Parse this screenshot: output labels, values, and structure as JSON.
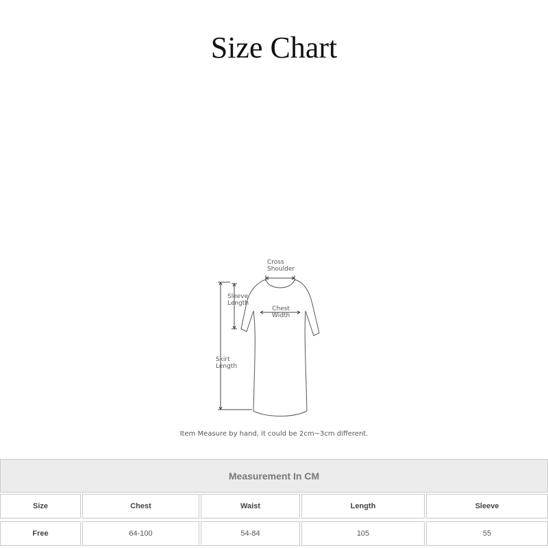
{
  "title": "Size Chart",
  "diagram": {
    "cross_shoulder": [
      "Cross",
      "Shoulder"
    ],
    "sleeve_length": [
      "Sleeve",
      "Length"
    ],
    "chest_width": [
      "Chest",
      "Width"
    ],
    "skirt_length": [
      "Skirt",
      "Length"
    ]
  },
  "note": "Item Measure by hand, it could be 2cm~3cm different.",
  "table": {
    "header": "Measurement In CM",
    "columns": [
      "Size",
      "Chest",
      "Waist",
      "Length",
      "Sleeve"
    ],
    "rows": [
      [
        "Free",
        "64-100",
        "54-84",
        "105",
        "55"
      ]
    ]
  }
}
